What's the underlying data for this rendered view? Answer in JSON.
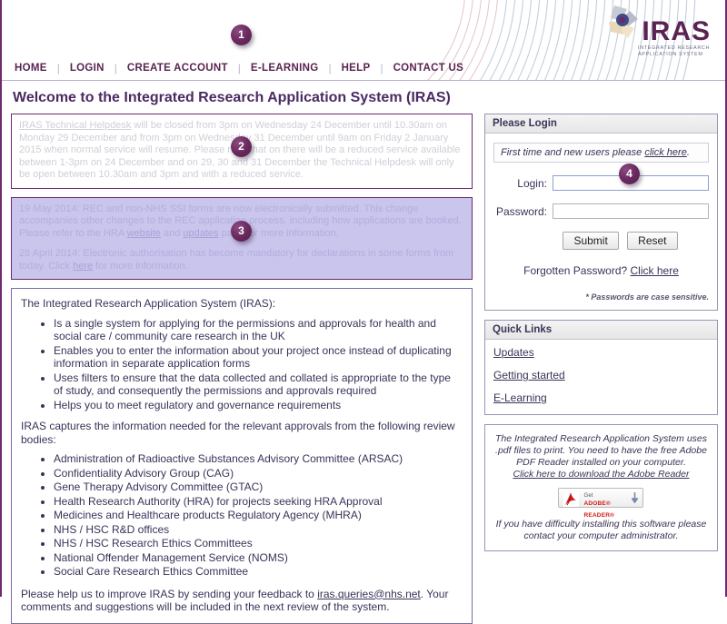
{
  "brand": {
    "logo_text": "IRAS",
    "logo_subtitle_line1": "INTEGRATED RESEARCH",
    "logo_subtitle_line2": "APPLICATION SYSTEM",
    "accent_purple": "#5a2352",
    "border_purple": "#6d2a6d",
    "lavender_fill": "#c9c5ec"
  },
  "nav": {
    "items": [
      {
        "label": "HOME"
      },
      {
        "label": "LOGIN"
      },
      {
        "label": "CREATE ACCOUNT"
      },
      {
        "label": "E-LEARNING"
      },
      {
        "label": "HELP"
      },
      {
        "label": "CONTACT US"
      }
    ]
  },
  "page_title": "Welcome to the Integrated Research Application System (IRAS)",
  "notices": {
    "helpdesk": {
      "link_text": "IRAS Technical Helpdesk",
      "body": " will be closed from 3pm on Wednesday 24 December until 10.30am on Monday 29 December and from 3pm on Wednesday 31 December until 9am on Friday 2 January 2015 when normal service will resume. Please note that on there will be a reduced service available between 1-3pm on 24 December and on 29, 30 and 31 December the Technical Helpdesk will only be open between 10.30am and 3pm and with a reduced service."
    },
    "updates": {
      "item1_part1": "19 May 2014: REC and non-NHS SSI forms are now electronically submitted. This change accompanies other changes to the REC application process, including how applications are booked. Please refer to the HRA ",
      "item1_link1": "website",
      "item1_part2": " and ",
      "item1_link2": "updates",
      "item1_part3": " page for more information.",
      "item2_part1": "28 April 2014: Electronic authorisation has become mandatory for declarations in some forms from today. Click ",
      "item2_link": "here",
      "item2_part2": " for more information."
    }
  },
  "info": {
    "intro": "The Integrated Research Application System (IRAS):",
    "features": [
      "Is a single system for applying for the permissions and approvals for health and social care / community care research in the UK",
      "Enables you to enter the information about your project once instead of duplicating information in separate application forms",
      "Uses filters to ensure that the data collected and collated is appropriate to the type of study, and consequently the permissions and approvals required",
      "Helps you to meet regulatory and governance requirements"
    ],
    "bodies_intro": "IRAS captures the information needed for the relevant approvals from the following review bodies:",
    "bodies": [
      "Administration of Radioactive Substances Advisory Committee (ARSAC)",
      "Confidentiality Advisory Group (CAG)",
      "Gene Therapy Advisory Committee (GTAC)",
      "Health Research Authority (HRA) for projects seeking HRA Approval",
      "Medicines and Healthcare products Regulatory Agency (MHRA)",
      "NHS / HSC R&D offices",
      "NHS / HSC Research Ethics Committees",
      "National Offender Management Service (NOMS)",
      "Social Care Research Ethics Committee"
    ],
    "feedback_part1": "Please help us to improve IRAS by sending your feedback to ",
    "feedback_email": "iras.queries@nhs.net",
    "feedback_part2": ". Your comments and suggestions will be included in the next review of the system."
  },
  "login": {
    "panel_title": "Please Login",
    "firsttime_text": "First time and new users please ",
    "firsttime_link": "click here",
    "firsttime_suffix": ".",
    "login_label": "Login:",
    "login_value": "",
    "password_label": "Password:",
    "password_value": "",
    "submit_label": "Submit",
    "reset_label": "Reset",
    "forgot_text": "Forgotten Password? ",
    "forgot_link": "Click here",
    "case_note": "* Passwords are case sensitive."
  },
  "quick_links": {
    "panel_title": "Quick Links",
    "items": [
      {
        "label": "Updates"
      },
      {
        "label": "Getting started"
      },
      {
        "label": "E-Learning"
      }
    ]
  },
  "pdf_notice": {
    "line1": "The Integrated Research Application System uses .pdf files to print. You need to have the free Adobe PDF Reader installed on your computer.",
    "download_link": "Click here to download the Adobe Reader",
    "adobe_get": "Get",
    "adobe_name": "ADOBE® READER®",
    "line2": "If you have difficulty installing this software please contact your computer administrator."
  },
  "markers": [
    {
      "number": "1"
    },
    {
      "number": "2"
    },
    {
      "number": "3"
    },
    {
      "number": "4"
    }
  ]
}
